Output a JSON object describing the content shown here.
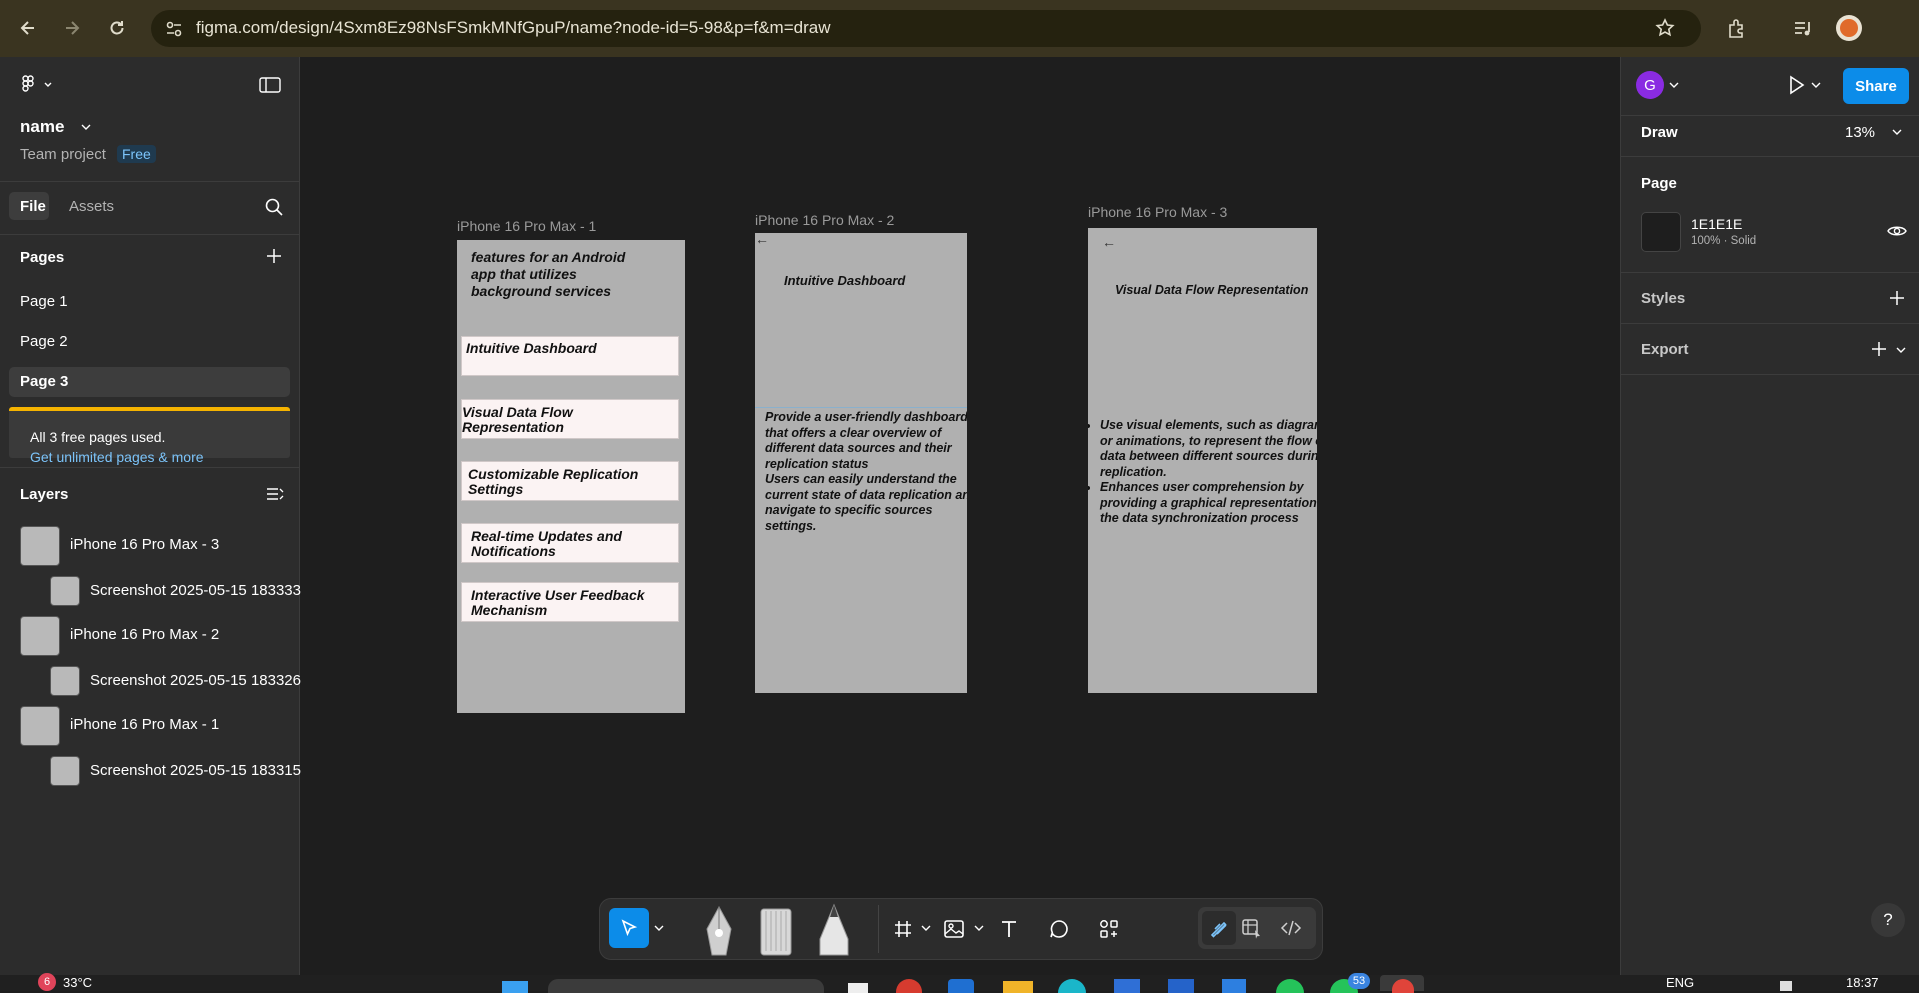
{
  "browser": {
    "url": "figma.com/design/4Sxm8Ez98NsFSmkMNfGpuP/name?node-id=5-98&p=f&m=draw"
  },
  "file": {
    "name": "name",
    "team": "Team project",
    "plan_badge": "Free"
  },
  "left_tabs": {
    "file": "File",
    "assets": "Assets"
  },
  "pages": {
    "title": "Pages",
    "items": [
      "Page 1",
      "Page 2",
      "Page 3"
    ]
  },
  "upgrade": {
    "message": "All 3 free pages used.",
    "link": "Get unlimited pages & more"
  },
  "layers": {
    "title": "Layers",
    "items": [
      {
        "label": "iPhone 16 Pro Max - 3",
        "level": 0
      },
      {
        "label": "Screenshot 2025-05-15 183333",
        "level": 1
      },
      {
        "label": "iPhone 16 Pro Max - 2",
        "level": 0
      },
      {
        "label": "Screenshot 2025-05-15 183326",
        "level": 1
      },
      {
        "label": "iPhone 16 Pro Max - 1",
        "level": 0
      },
      {
        "label": "Screenshot 2025-05-15 183315",
        "level": 1
      }
    ]
  },
  "right_panel": {
    "avatar_letter": "G",
    "share_label": "Share",
    "mode": "Draw",
    "zoom": "13%",
    "page_section": "Page",
    "fill_hex": "1E1E1E",
    "fill_detail": "100% · Solid",
    "fill_color": "#1E1E1E",
    "styles": "Styles",
    "export": "Export",
    "help": "?"
  },
  "frames": {
    "f1": {
      "label": "iPhone 16 Pro Max - 1",
      "intro": "features for an Android app that utilizes background services",
      "cards": [
        "Intuitive Dashboard",
        "Visual Data Flow Representation",
        "Customizable Replication Settings",
        "Real-time Updates and Notifications",
        "Interactive User Feedback Mechanism"
      ]
    },
    "f2": {
      "label": "iPhone 16 Pro Max - 2",
      "back": "←",
      "heading": "Intuitive Dashboard",
      "bullets": [
        "Provide a user-friendly dashboard that offers a clear overview of different data sources and their replication status",
        "Users can easily understand the current state of data replication and navigate to specific sources settings."
      ]
    },
    "f3": {
      "label": "iPhone 16 Pro Max - 3",
      "back": "←",
      "heading": "Visual Data Flow Representation",
      "bullets": [
        "Use visual elements, such as diagrams or animations, to represent the flow of data between different sources during replication.",
        "Enhances user comprehension by providing a graphical representation of the data synchronization process"
      ]
    }
  },
  "taskbar": {
    "weather_badge": "6",
    "temperature": "33°C",
    "language": "ENG",
    "time": "18:37",
    "app_badge": "53"
  },
  "colors": {
    "accent": "#0d99ff",
    "share_bg": "#0c8ce9",
    "tool_active": "#0c8ce9",
    "browser_bar": "#3a3420",
    "panel_bg": "#2c2c2c",
    "canvas_bg": "#1e1e1e"
  }
}
